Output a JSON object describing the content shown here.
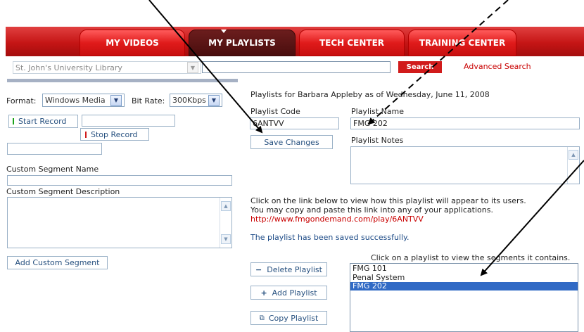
{
  "nav": {
    "tabs": [
      {
        "label": "MY VIDEOS"
      },
      {
        "label": "MY PLAYLISTS"
      },
      {
        "label": "TECH CENTER"
      },
      {
        "label": "TRAINING CENTER"
      }
    ]
  },
  "search": {
    "library_select": "St. John's University Library",
    "query": "",
    "button_label": "Search",
    "advanced_link": "Advanced Search"
  },
  "left": {
    "format_label": "Format:",
    "format_value": "Windows Media",
    "bitrate_label": "Bit Rate:",
    "bitrate_value": "300Kbps",
    "start_record": "Start Record",
    "stop_record": "Stop Record",
    "segment_name_label": "Custom Segment Name",
    "segment_desc_label": "Custom Segment Description",
    "add_segment_button": "Add Custom Segment"
  },
  "right": {
    "header": "Playlists for Barbara Appleby as of Wednesday, June 11, 2008",
    "code_label": "Playlist Code",
    "code_value": "6ANTVV",
    "name_label": "Playlist Name",
    "name_value": "FMG 202",
    "save_button": "Save Changes",
    "notes_label": "Playlist Notes",
    "link_info_1": "Click on the link below to view how this playlist will appear to its users.",
    "link_info_2": "You may copy and paste this link into any of your applications.",
    "link_url": "http://www.fmgondemand.com/play/6ANTVV",
    "saved_message": "The playlist has been saved successfully.",
    "list_hint": "Click on a playlist to view the segments it contains.",
    "delete_button": "Delete Playlist",
    "add_button": "Add Playlist",
    "copy_button": "Copy Playlist",
    "playlists": [
      "FMG 101",
      "Penal System",
      "FMG 202"
    ],
    "selected_playlist": "FMG 202"
  },
  "icons": {
    "start_marker": "green-bar-icon",
    "stop_marker": "red-bar-icon",
    "delete": "minus-icon",
    "add": "plus-icon",
    "copy": "copy-icon"
  },
  "colors": {
    "nav_red": "#d11b1b",
    "nav_active": "#4a0d0d",
    "link_blue": "#1c4a86",
    "alert_red": "#c90000",
    "selected_row": "#316ac5"
  }
}
